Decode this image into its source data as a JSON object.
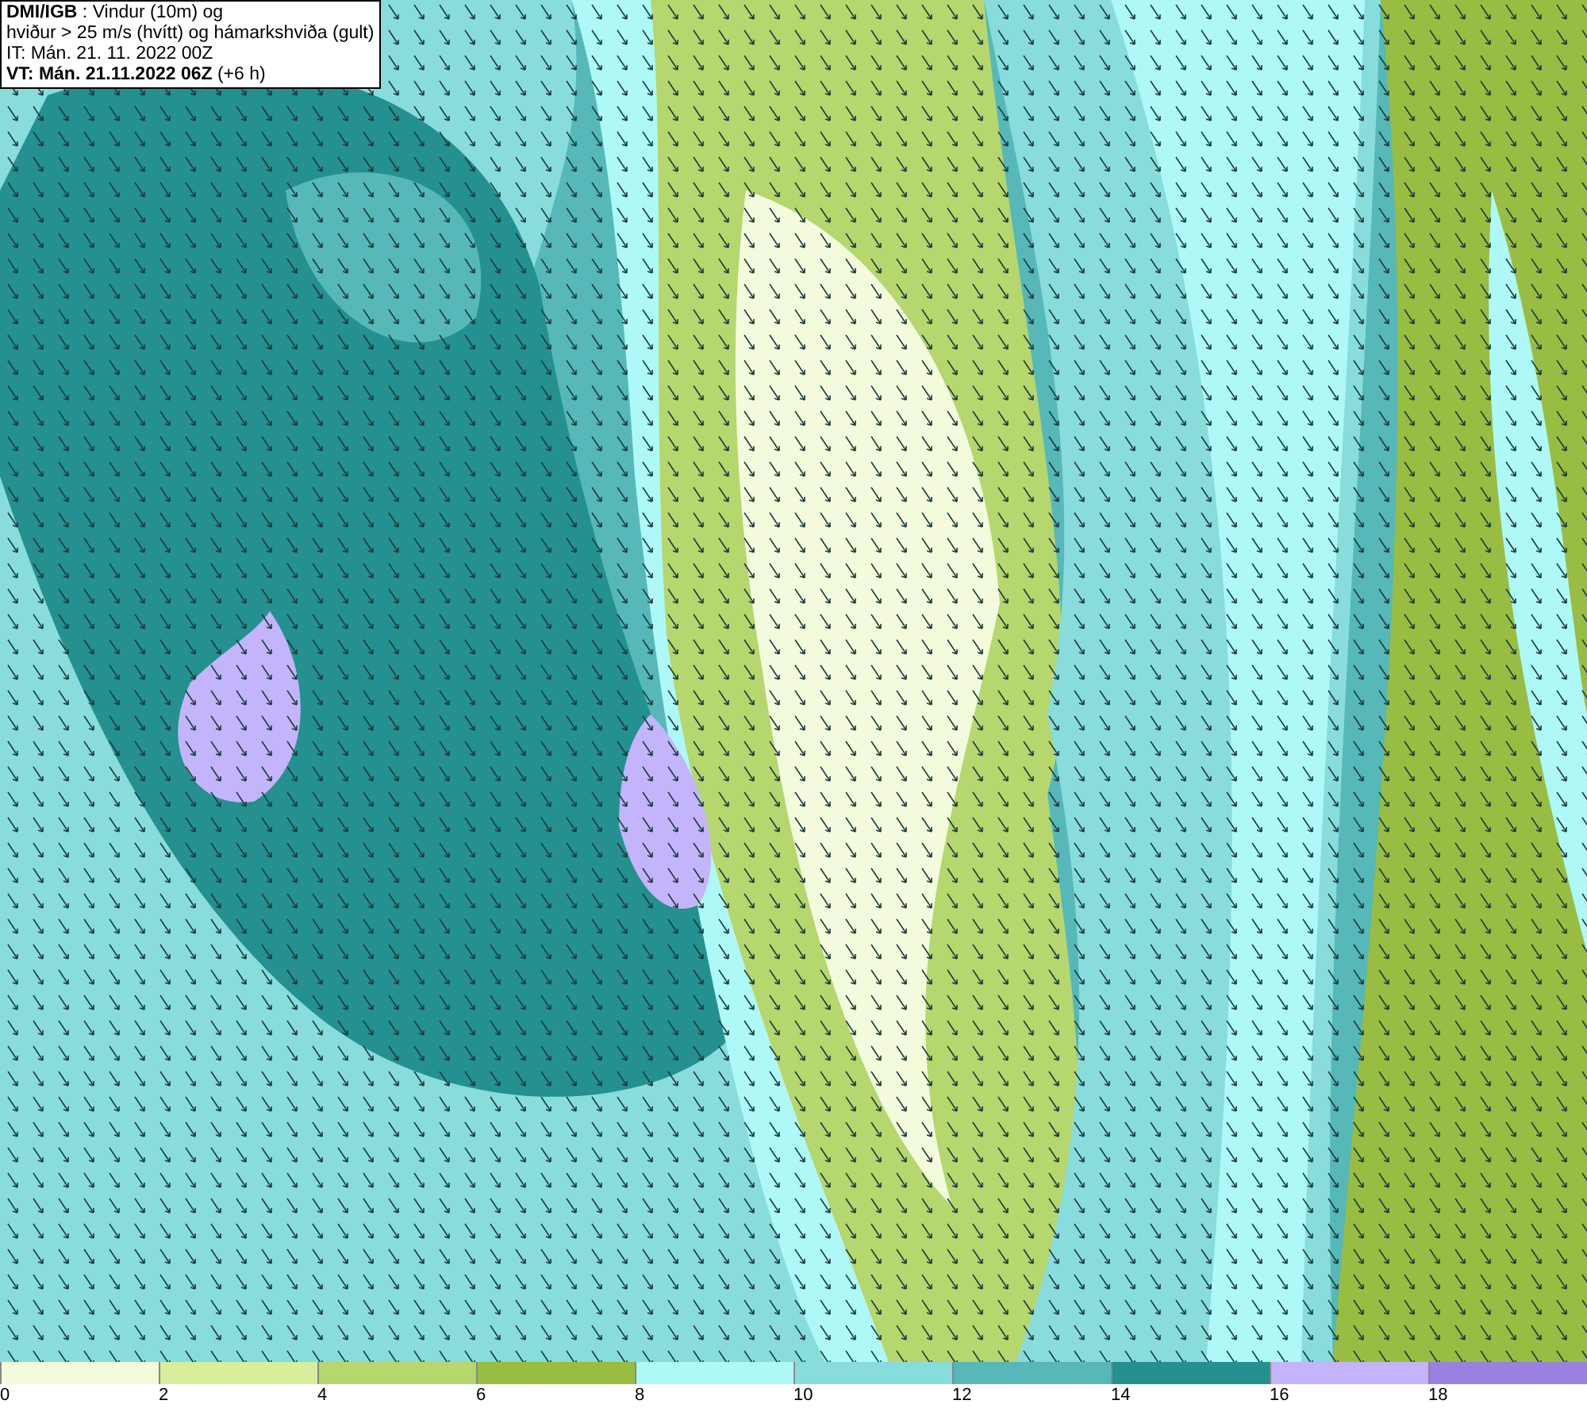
{
  "info_box": {
    "lines": [
      "**DMI/IGB** : Vindur (10m) og",
      "hviður > 25 m/s (hvítt) og hámarkshviða (gult)",
      "IT: Mán. 21. 11. 2022 00Z",
      "**VT: Mán. 21.11.2022 06Z** (+6 h)"
    ]
  },
  "legend": [
    {
      "label": "0",
      "color": "#f4fadc"
    },
    {
      "label": "2",
      "color": "#d8ee9c"
    },
    {
      "label": "4",
      "color": "#b6d66e"
    },
    {
      "label": "6",
      "color": "#98bd42"
    },
    {
      "label": "8",
      "color": "#aef8f8"
    },
    {
      "label": "10",
      "color": "#88dcdc"
    },
    {
      "label": "12",
      "color": "#56b8b8"
    },
    {
      "label": "14",
      "color": "#249090"
    },
    {
      "label": "16",
      "color": "#c4b4fc"
    },
    {
      "label": "18",
      "color": "#9a80e0"
    }
  ]
}
